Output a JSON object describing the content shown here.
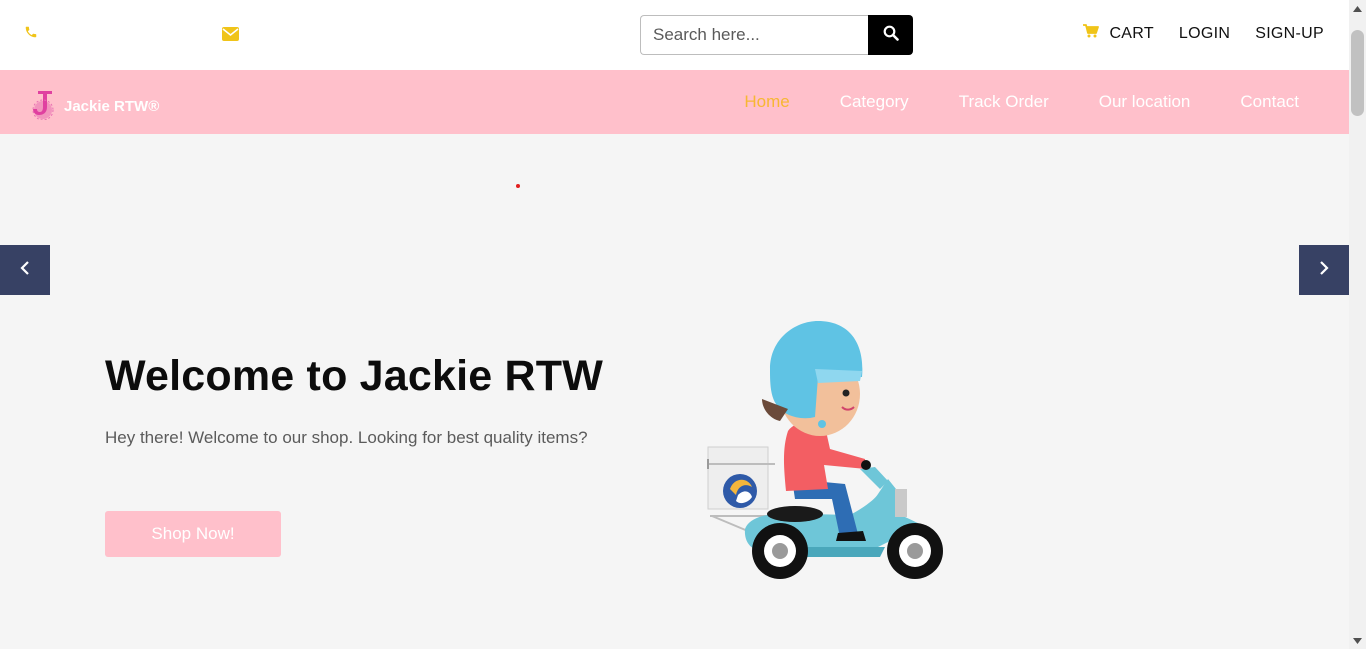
{
  "topbar": {
    "phone_icon": "phone-icon",
    "mail_icon": "envelope-icon",
    "search": {
      "placeholder": "Search here..."
    },
    "cart_label": "CART",
    "login_label": "LOGIN",
    "signup_label": "SIGN-UP"
  },
  "navbar": {
    "brand": "Jackie RTW®",
    "items": [
      {
        "label": "Home"
      },
      {
        "label": "Category"
      },
      {
        "label": "Track Order"
      },
      {
        "label": "Our location"
      },
      {
        "label": "Contact"
      }
    ]
  },
  "hero": {
    "title": "Welcome to Jackie RTW",
    "subtitle": "Hey there! Welcome to our shop. Looking for best quality items?",
    "cta_label": "Shop Now!"
  },
  "colors": {
    "accent_pink": "#ffc0cb",
    "accent_yellow": "#f0c419",
    "active_nav": "#f7b733",
    "arrow_bg": "#374164",
    "hero_bg": "#f5f5f5"
  }
}
